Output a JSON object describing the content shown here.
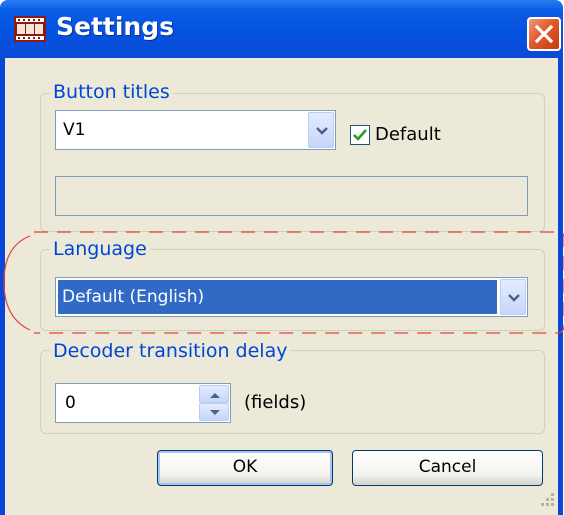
{
  "window": {
    "title": "Settings"
  },
  "icons": {
    "app": "filmstrip-icon",
    "close": "close-icon",
    "dropdown": "chevron-down-icon",
    "spin_up": "chevron-up-icon",
    "spin_down": "chevron-down-icon",
    "grip": "resize-grip-icon"
  },
  "button_titles": {
    "group_label": "Button titles",
    "selected": "V1",
    "default_checked": true,
    "default_label": "Default",
    "title_value": ""
  },
  "language": {
    "group_label": "Language",
    "selected": "Default (English)"
  },
  "decoder": {
    "group_label": "Decoder transition delay",
    "value": "0",
    "unit_label": "(fields)"
  },
  "buttons": {
    "ok": "OK",
    "cancel": "Cancel"
  },
  "colors": {
    "titlebar": "#0552e0",
    "face": "#ece9d8",
    "group_label": "#0046d5",
    "selection": "#316ac5",
    "close": "#e25a2c",
    "annotation": "#e0433a"
  }
}
